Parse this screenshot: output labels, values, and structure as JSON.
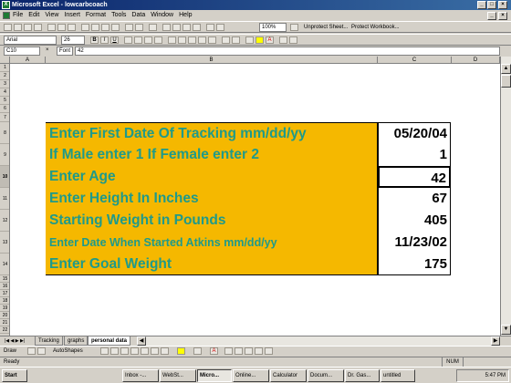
{
  "window": {
    "title": "Microsoft Excel - lowcarbcoach"
  },
  "menu": [
    "File",
    "Edit",
    "View",
    "Insert",
    "Format",
    "Tools",
    "Data",
    "Window",
    "Help"
  ],
  "toolbar": {
    "zoom": "100%",
    "unprotect_sheet": "Unprotect Sheet...",
    "protect_workbook": "Protect Workbook...",
    "font": "Arial",
    "font_size": "26"
  },
  "formula_bar": {
    "name_box": "C10",
    "label": "Font",
    "value": "42"
  },
  "columns": [
    "A",
    "B",
    "C",
    "D"
  ],
  "rows": [
    "1",
    "2",
    "3",
    "4",
    "5",
    "6",
    "7",
    "8",
    "9",
    "10",
    "11",
    "12",
    "13",
    "14",
    "15",
    "16",
    "17",
    "18",
    "19",
    "20",
    "21",
    "22",
    "23",
    "24",
    "25"
  ],
  "entries": [
    {
      "label": "Enter First Date Of Tracking mm/dd/yy",
      "value": "05/20/04"
    },
    {
      "label": "If Male enter 1 If Female enter 2",
      "value": "1"
    },
    {
      "label": "Enter Age",
      "value": "42"
    },
    {
      "label": "Enter Height In Inches",
      "value": "67"
    },
    {
      "label": "Starting Weight in Pounds",
      "value": "405"
    },
    {
      "label": "Enter Date When Started Atkins mm/dd/yy",
      "value": "11/23/02"
    },
    {
      "label": "Enter Goal Weight",
      "value": "175"
    }
  ],
  "sheet_tabs": [
    "Tracking",
    "graphs",
    "personal data"
  ],
  "drawing": {
    "draw": "Draw",
    "autoshapes": "AutoShapes"
  },
  "status": {
    "ready": "Ready",
    "num": "NUM"
  },
  "taskbar": {
    "start": "Start",
    "tasks": [
      "Inbox -...",
      "WebSt...",
      "Micro...",
      "Online...",
      "Calculator",
      "Docum...",
      "Dr. Gas...",
      "untitled"
    ],
    "clock": "5:47 PM"
  },
  "colors": {
    "label_bg": "#f5b800",
    "label_text": "#1f9a8a",
    "title_bar": "#0a246a"
  }
}
